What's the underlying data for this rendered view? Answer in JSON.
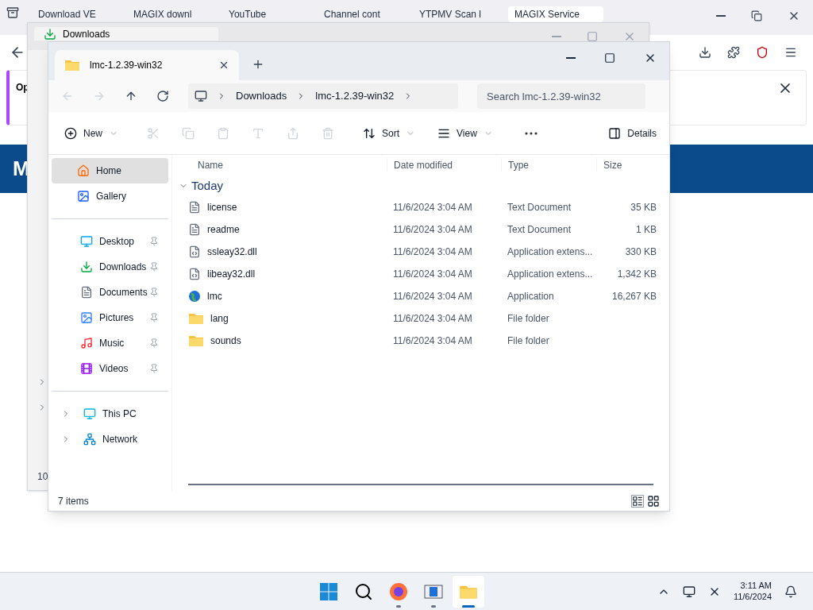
{
  "browser": {
    "tabs": [
      {
        "title": "Download VE",
        "selected": false
      },
      {
        "title": "MAGIX downl",
        "selected": false
      },
      {
        "title": "YouTube",
        "selected": false
      },
      {
        "title": "Channel cont",
        "selected": false
      },
      {
        "title": "YTPMV Scan l",
        "selected": false
      },
      {
        "title": "MAGIX Service",
        "selected": true
      }
    ],
    "notification": {
      "text": "Op"
    },
    "banner": {
      "text": "M"
    }
  },
  "back_window": {
    "tab": "Downloads",
    "status": "10"
  },
  "explorer": {
    "tab": "lmc-1.2.39-win32",
    "breadcrumb": [
      "Downloads",
      "lmc-1.2.39-win32"
    ],
    "search": {
      "placeholder": "Search lmc-1.2.39-win32"
    },
    "toolbar": [
      {
        "kind": "new",
        "label": "New"
      },
      {
        "kind": "sort",
        "label": "Sort"
      },
      {
        "kind": "view",
        "label": "View"
      }
    ],
    "details": "Details",
    "sidebar": [
      [
        {
          "label": "Home",
          "kind": "plain",
          "selected": true
        },
        {
          "label": "Gallery",
          "kind": "plain",
          "selected": false
        }
      ],
      [
        {
          "label": "Desktop",
          "kind": "pinned",
          "selected": false
        },
        {
          "label": "Downloads",
          "kind": "pinned",
          "selected": false
        },
        {
          "label": "Documents",
          "kind": "pinned",
          "selected": false
        },
        {
          "label": "Pictures",
          "kind": "pinned",
          "selected": false
        },
        {
          "label": "Music",
          "kind": "pinned",
          "selected": false
        },
        {
          "label": "Videos",
          "kind": "pinned",
          "selected": false
        }
      ],
      [
        {
          "label": "This PC",
          "kind": "tree",
          "selected": false
        },
        {
          "label": "Network",
          "kind": "tree",
          "selected": false
        }
      ]
    ],
    "columns": [
      "Name",
      "Date modified",
      "Type",
      "Size"
    ],
    "group": {
      "label": "Today",
      "expanded": true
    },
    "rows": [
      {
        "kind": "text",
        "name": "license",
        "date": "11/6/2024 3:04 AM",
        "type": "Text Document",
        "size": "35 KB"
      },
      {
        "kind": "text",
        "name": "readme",
        "date": "11/6/2024 3:04 AM",
        "type": "Text Document",
        "size": "1 KB"
      },
      {
        "kind": "dll",
        "name": "ssleay32.dll",
        "date": "11/6/2024 3:04 AM",
        "type": "Application extens...",
        "size": "330 KB"
      },
      {
        "kind": "dll",
        "name": "libeay32.dll",
        "date": "11/6/2024 3:04 AM",
        "type": "Application extens...",
        "size": "1,342 KB"
      },
      {
        "kind": "app",
        "name": "lmc",
        "date": "11/6/2024 3:04 AM",
        "type": "Application",
        "size": "16,267 KB"
      },
      {
        "kind": "folder",
        "name": "lang",
        "date": "11/6/2024 3:04 AM",
        "type": "File folder"
      },
      {
        "kind": "folder",
        "name": "sounds",
        "date": "11/6/2024 3:04 AM",
        "type": "File folder"
      }
    ],
    "status": "7 items"
  },
  "taskbar": {
    "apps": [
      {
        "kind": "start",
        "running": false,
        "selected": false
      },
      {
        "kind": "search",
        "running": false,
        "selected": false
      },
      {
        "kind": "firefox",
        "running": true,
        "selected": false
      },
      {
        "kind": "media",
        "running": true,
        "selected": false
      },
      {
        "kind": "explorer",
        "running": true,
        "selected": true
      }
    ],
    "time": "3:11 AM",
    "date": "11/6/2024"
  }
}
